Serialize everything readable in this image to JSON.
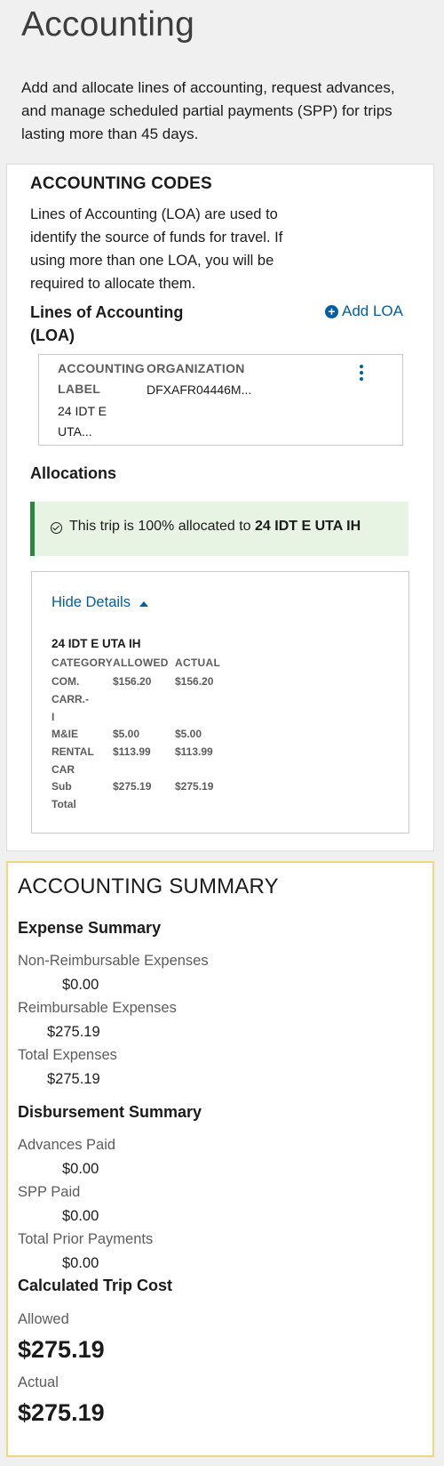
{
  "page": {
    "title": "Accounting",
    "intro": "Add and allocate lines of accounting, request advances, and manage scheduled partial payments (SPP) for trips lasting more than 45 days."
  },
  "accounting_codes": {
    "heading": "ACCOUNTING CODES",
    "description": "Lines of Accounting (LOA) are used to identify the source of funds for travel. If using more than one LOA, you will be required to allocate them.",
    "loa_heading": "Lines of Accounting (LOA)",
    "add_loa_label": "Add LOA",
    "loa_table": {
      "col_label_1": "ACCOUNTING",
      "col_label_2": "LABEL",
      "col_org": "ORGANIZATION",
      "label_value_1": "24 IDT E",
      "label_value_2": "UTA...",
      "org_value": "DFXAFR04446M..."
    }
  },
  "allocations": {
    "heading": "Allocations",
    "alert_prefix": "This trip is 100% allocated to ",
    "alert_account": "24 IDT E UTA IH",
    "hide_details_label": "Hide Details",
    "account_name": "24 IDT E UTA IH",
    "columns": [
      "CATEGORY",
      "ALLOWED",
      "ACTUAL"
    ],
    "rows": [
      {
        "category_lines": [
          "COM.",
          "CARR.-",
          "I"
        ],
        "allowed": "$156.20",
        "actual": "$156.20"
      },
      {
        "category_lines": [
          "M&IE"
        ],
        "allowed": "$5.00",
        "actual": "$5.00"
      },
      {
        "category_lines": [
          "RENTAL",
          "CAR"
        ],
        "allowed": "$113.99",
        "actual": "$113.99"
      },
      {
        "category_lines": [
          "Sub",
          "Total"
        ],
        "allowed": "$275.19",
        "actual": "$275.19"
      }
    ]
  },
  "summary": {
    "title": "ACCOUNTING SUMMARY",
    "expense_heading": "Expense Summary",
    "non_reimbursable_label": "Non-Reimbursable Expenses",
    "non_reimbursable_value": "$0.00",
    "reimbursable_label": "Reimbursable Expenses",
    "reimbursable_value": "$275.19",
    "total_expenses_label": "Total Expenses",
    "total_expenses_value": "$275.19",
    "disbursement_heading": "Disbursement Summary",
    "advances_label": "Advances Paid",
    "advances_value": "$0.00",
    "spp_label": "SPP Paid",
    "spp_value": "$0.00",
    "prior_label": "Total Prior Payments",
    "prior_value": "$0.00",
    "trip_cost_heading": "Calculated Trip Cost",
    "allowed_label": "Allowed",
    "allowed_value": "$275.19",
    "actual_label": "Actual",
    "actual_value": "$275.19"
  },
  "colors": {
    "link": "#005ea2",
    "success_border": "#2e8540",
    "success_bg": "#e7f4e4",
    "summary_border": "#f0d77a"
  }
}
